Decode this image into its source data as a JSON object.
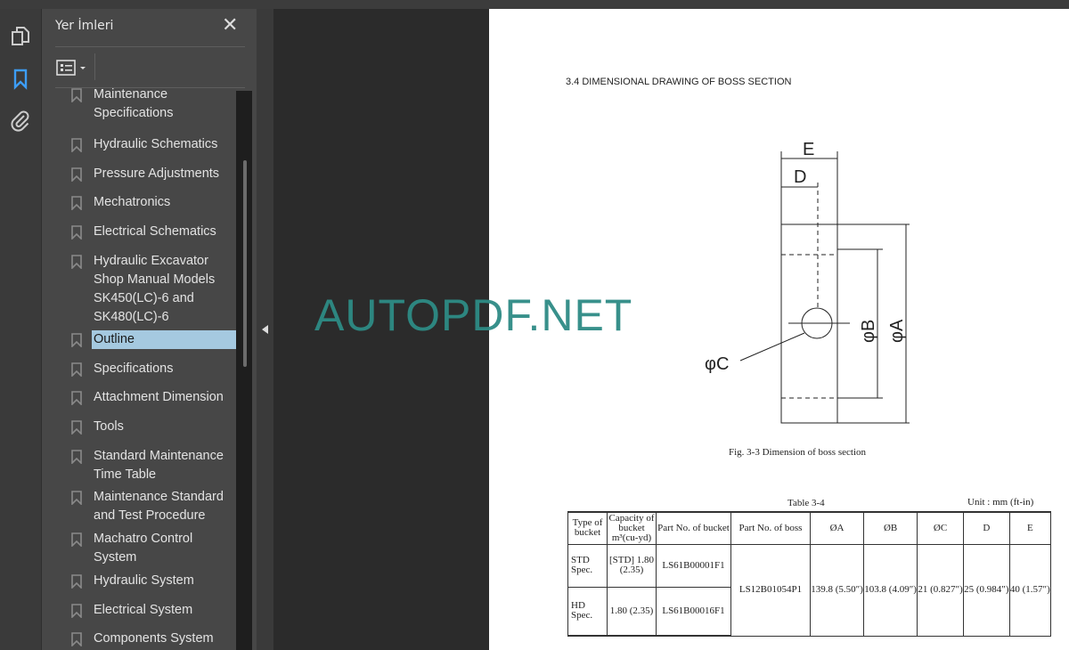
{
  "sidebar": {
    "title": "Yer İmleri",
    "close": "✕",
    "bookmarks": [
      {
        "label": "Maintenance Specifications"
      },
      {
        "label": "Hydraulic Schematics"
      },
      {
        "label": "Pressure Adjustments"
      },
      {
        "label": "Mechatronics"
      },
      {
        "label": "Electrical Schematics"
      },
      {
        "label": "Hydraulic Excavator Shop Manual Models SK450(LC)-6 and SK480(LC)-6"
      },
      {
        "label": "Outline",
        "selected": true
      },
      {
        "label": "Specifications"
      },
      {
        "label": "Attachment Dimension"
      },
      {
        "label": "Tools"
      },
      {
        "label": "Standard Maintenance Time Table"
      },
      {
        "label": "Maintenance Standard and Test Procedure"
      },
      {
        "label": "Machatro Control System"
      },
      {
        "label": "Hydraulic System"
      },
      {
        "label": "Electrical System"
      },
      {
        "label": "Components System"
      }
    ]
  },
  "rail": {
    "icons": [
      "pages-icon",
      "bookmark-icon",
      "attachment-icon"
    ],
    "accent": "#3d9df5"
  },
  "watermark": "AUTOPDF.NET",
  "document": {
    "section": "3.4  DIMENSIONAL DRAWING OF BOSS SECTION",
    "labels": {
      "E": "E",
      "D": "D",
      "B": "φB",
      "A": "φA",
      "C": "φC"
    },
    "figure_caption": "Fig. 3-3    Dimension of boss section",
    "table_caption": "Table 3-4",
    "unit": "Unit : mm (ft-in)",
    "headers": [
      "Type of bucket",
      "Capacity of bucket m³(cu-yd)",
      "Part No. of bucket",
      "Part No. of boss",
      "ØA",
      "ØB",
      "ØC",
      "D",
      "E"
    ],
    "rows": [
      {
        "type": "STD Spec.",
        "capacity": "[STD] 1.80 (2.35)",
        "bucket_part": "LS61B00001F1"
      },
      {
        "type": "HD Spec.",
        "capacity": "1.80 (2.35)",
        "bucket_part": "LS61B00016F1"
      }
    ],
    "shared": {
      "boss_part": "LS12B01054P1",
      "A": "139.8 (5.50″)",
      "B": "103.8 (4.09″)",
      "C": "21 (0.827″)",
      "D": "25 (0.984″)",
      "E": "40 (1.57″)"
    }
  }
}
